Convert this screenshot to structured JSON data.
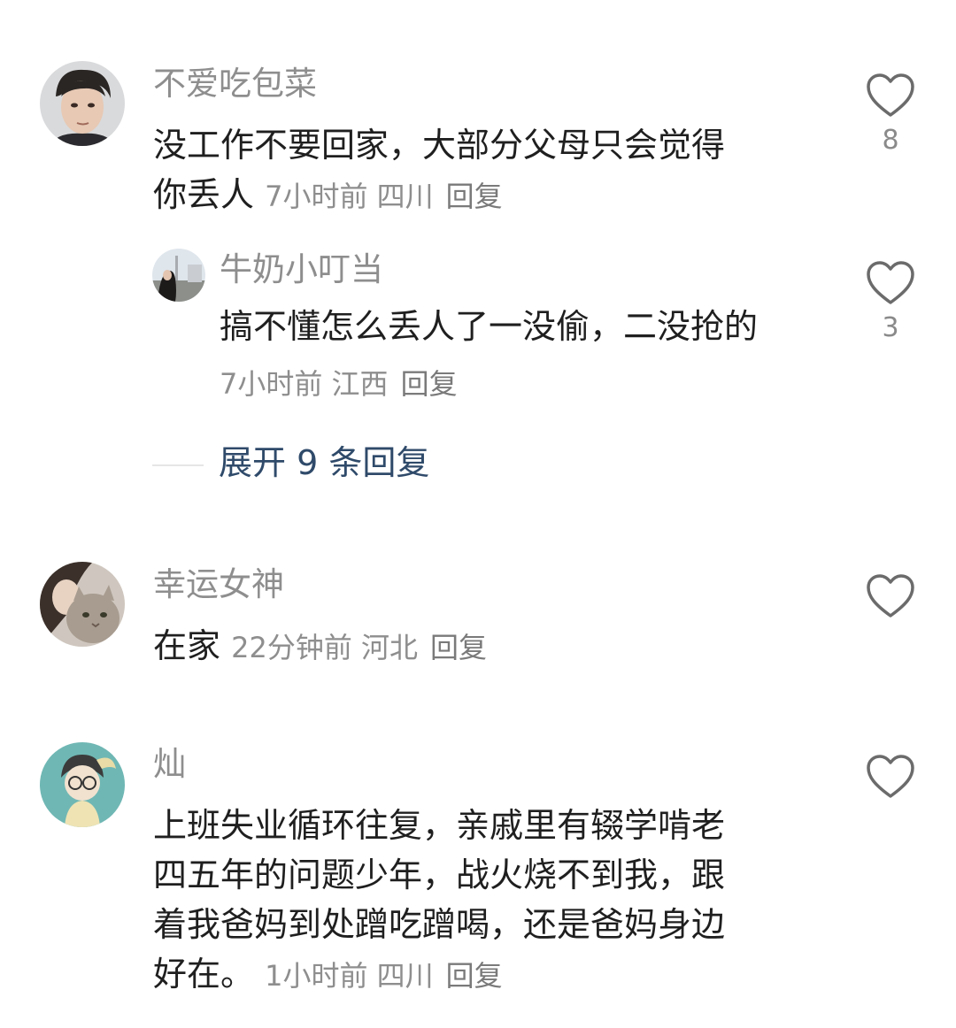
{
  "comments": [
    {
      "username": "不爱吃包菜",
      "text_line1": "没工作不要回家，大部分父母只会觉得",
      "text_line2": "你丢人",
      "time": "7小时前",
      "location": "四川",
      "reply_label": "回复",
      "like_count": "8",
      "avatar_icon": "young-man-avatar-icon",
      "reply": {
        "username": "牛奶小叮当",
        "text": "搞不懂怎么丢人了一没偷，二没抢的",
        "time": "7小时前",
        "location": "江西",
        "reply_label": "回复",
        "like_count": "3",
        "avatar_icon": "girl-outdoor-avatar-icon"
      },
      "expand_label": "展开 9 条回复"
    },
    {
      "username": "幸运女神",
      "text": "在家",
      "time": "22分钟前",
      "location": "河北",
      "reply_label": "回复",
      "like_count": "",
      "avatar_icon": "girl-with-cat-avatar-icon"
    },
    {
      "username": "灿",
      "text_line1": "上班失业循环往复，亲戚里有辍学啃老",
      "text_line2": "四五年的问题少年，战火烧不到我，跟",
      "text_line3": "着我爸妈到处蹭吃蹭喝，还是爸妈身边",
      "text_line4": "好在。",
      "time": "1小时前",
      "location": "四川",
      "reply_label": "回复",
      "like_count": "",
      "avatar_icon": "cartoon-boy-avatar-icon"
    }
  ],
  "colors": {
    "username": "#8e8e8e",
    "text": "#1f1f1f",
    "meta": "#8e8e8e",
    "expand": "#2f4a6a",
    "heart_stroke": "#6b6b6b"
  }
}
